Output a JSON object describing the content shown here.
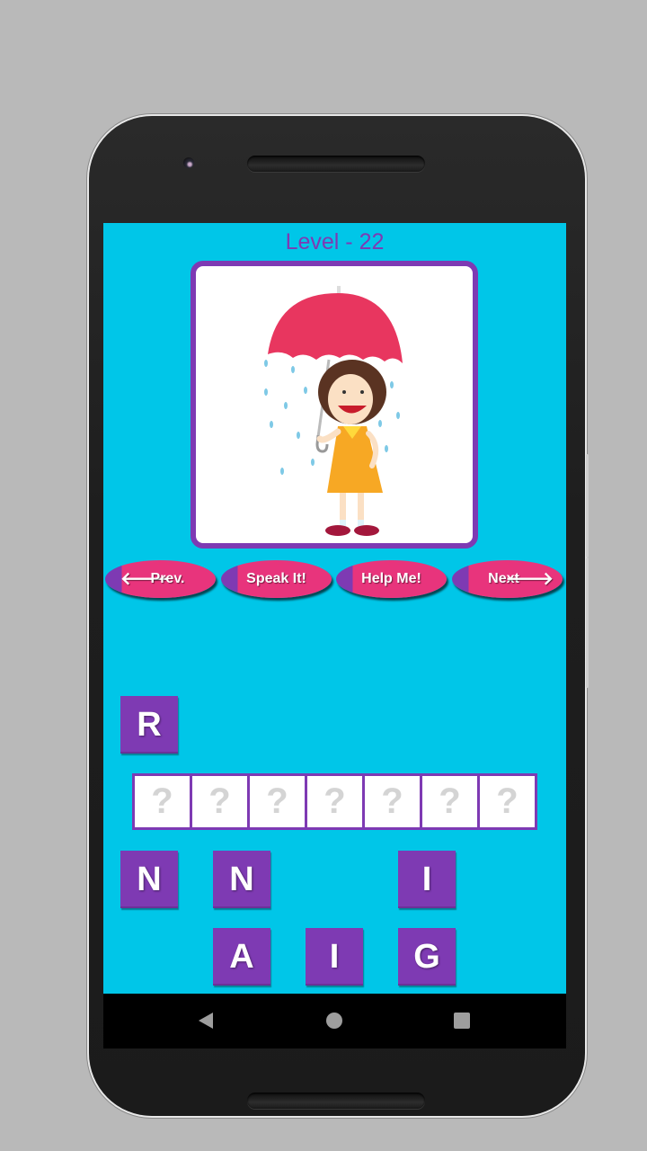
{
  "level": {
    "title": "Level - 22"
  },
  "picture": {
    "description": "girl-with-umbrella-in-rain"
  },
  "buttons": {
    "prev": {
      "label": "Prev.",
      "icon": "arrow-left-icon"
    },
    "speak": {
      "label": "Speak It!"
    },
    "help": {
      "label": "Help Me!"
    },
    "next": {
      "label": "Next",
      "icon": "arrow-right-icon"
    }
  },
  "extra_tile": {
    "letter": "R"
  },
  "answer_slots": [
    "?",
    "?",
    "?",
    "?",
    "?",
    "?",
    "?"
  ],
  "letter_tiles": {
    "row1": [
      "N",
      "N",
      "",
      "I"
    ],
    "row2": [
      "",
      "A",
      "I",
      "G"
    ]
  },
  "navigation": {
    "back": "back-icon",
    "home": "home-icon",
    "recents": "recents-icon"
  },
  "colors": {
    "background": "#00c6e8",
    "accent_purple": "#7e3ab3",
    "button_pink": "#e8347c"
  }
}
